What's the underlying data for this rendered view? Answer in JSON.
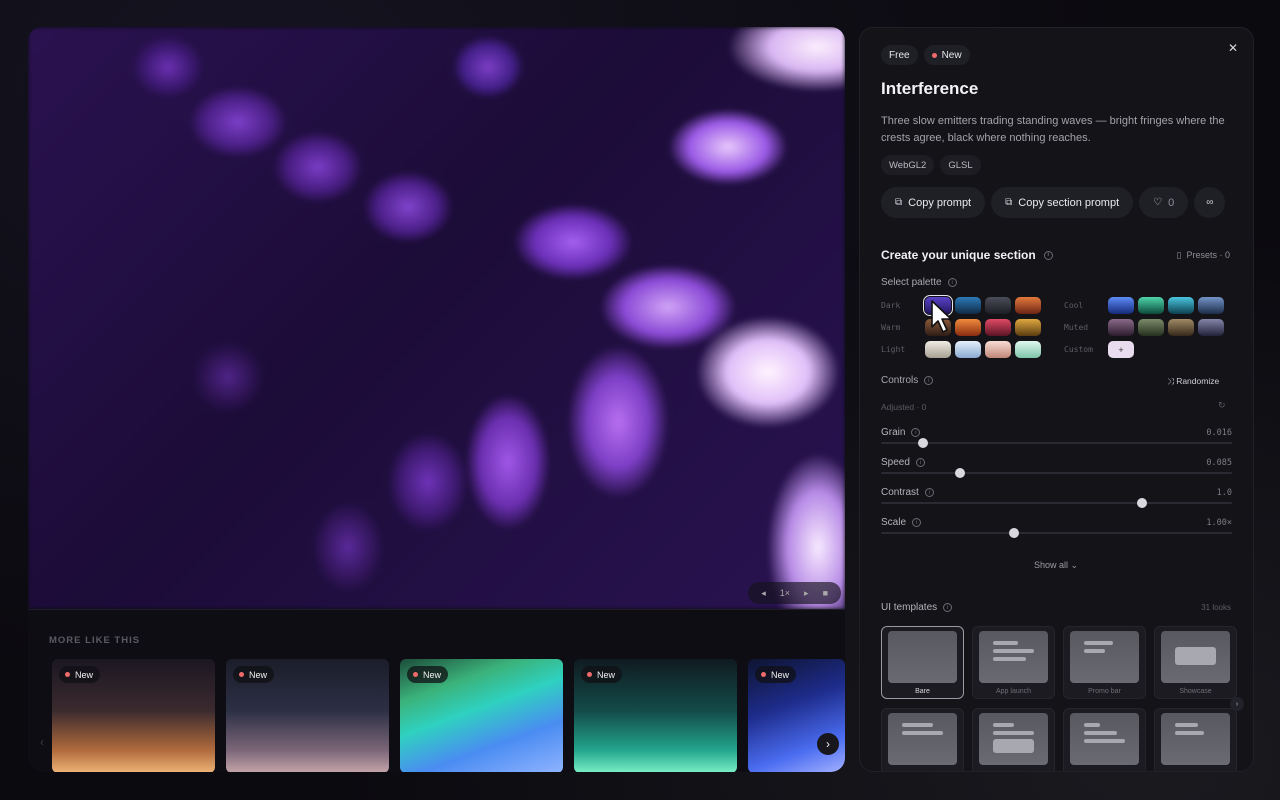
{
  "viewer": {
    "controls": [
      "◂",
      "1×",
      "▸",
      "■"
    ],
    "more_title": "MORE LIKE THIS",
    "more_items": [
      {
        "badge": "New"
      },
      {
        "badge": "New"
      },
      {
        "badge": "New"
      },
      {
        "badge": "New"
      },
      {
        "badge": "New"
      }
    ]
  },
  "panel": {
    "badges": {
      "free": "Free",
      "new": "New"
    },
    "title": "Interference",
    "description": "Three slow emitters trading standing waves — bright fringes where the crests agree, black where nothing reaches.",
    "tags": [
      "WebGL2",
      "GLSL"
    ],
    "actions": {
      "copy_prompt": "Copy prompt",
      "copy_section_prompt": "Copy section prompt",
      "likes": "0"
    },
    "create_title": "Create your unique section",
    "presets_label": "Presets · 0",
    "palette_label": "Select palette",
    "palette_groups": {
      "dark": "Dark",
      "warm": "Warm",
      "light": "Light",
      "cool": "Cool",
      "muted": "Muted",
      "custom": "Custom"
    },
    "swatch_colors": {
      "dark": [
        "#3b2a8c",
        "#1e4f7a",
        "#2b2d36",
        "#c4562a"
      ],
      "warm": [
        "#5b3a2c",
        "#e0692a",
        "#c43a52",
        "#c08a30"
      ],
      "light": [
        "#d6d0c4",
        "#c8dcf2",
        "#ecc6bd",
        "#bfe6da"
      ],
      "cool": [
        "#3c6fe0",
        "#2ea88a",
        "#27a6c0",
        "#4c6a98"
      ],
      "muted": [
        "#6a4a68",
        "#56664c",
        "#7a6a4e",
        "#5a5a7a"
      ],
      "custom_plus": "+"
    },
    "controls_label": "Controls",
    "randomize": "Randomize",
    "adjusted": "Adjusted · 0",
    "sliders": [
      {
        "label": "Grain",
        "value": "0.016",
        "fraction": 0.12
      },
      {
        "label": "Speed",
        "value": "0.085",
        "fraction": 0.225
      },
      {
        "label": "Contrast",
        "value": "1.0",
        "fraction": 0.745
      },
      {
        "label": "Scale",
        "value": "1.00×",
        "fraction": 0.38
      }
    ],
    "show_all": "Show all",
    "templates_label": "UI templates",
    "templates_count": "31 looks",
    "templates": [
      "Bare",
      "App launch",
      "Promo bar",
      "Showcase",
      "",
      "",
      "",
      ""
    ]
  }
}
